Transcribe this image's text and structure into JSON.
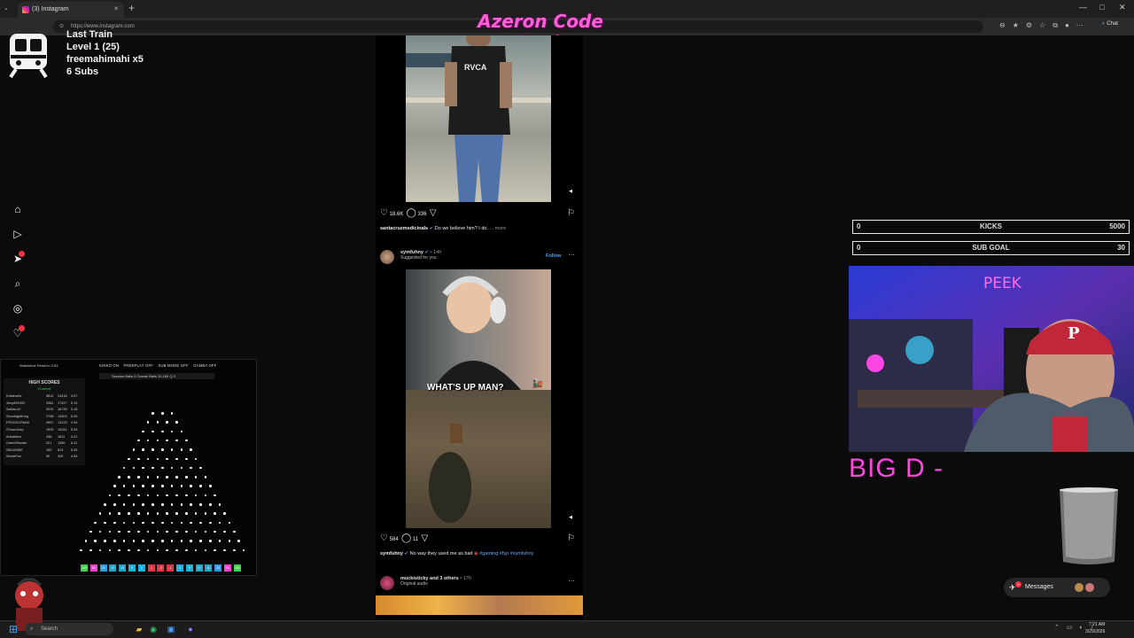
{
  "browser": {
    "tab_title": "(3) Instagram",
    "new_tab": "+",
    "url": "https://www.instagram.com",
    "chat_label": "Chat",
    "win_min": "—",
    "win_max": "□",
    "win_close": "✕"
  },
  "stream": {
    "title": "Azeron Code Peek",
    "train": {
      "title": "Last Train",
      "level": "Level 1  (25)",
      "user": "freemahimahi x5",
      "subs": "6 Subs"
    },
    "kicks": {
      "left": "0",
      "label": "KICKS",
      "right": "5000"
    },
    "sub_goal": {
      "left": "0",
      "label": "SUB GOAL",
      "right": "30"
    },
    "webcam_label": "PEEK",
    "big_text": "BIG D -"
  },
  "plinko": {
    "top_label": "Watchtime Reset in 2:53",
    "modes": [
      "KINKO ON",
      "FREEPLAY OFF",
      "SUB MODE OFF",
      "GAMBA OFF"
    ],
    "stats": "Session Balls  0     Overall Balls  20,185     Q  0",
    "hs_title": "HIGH SCORES",
    "hs_sub": "Channel",
    "scores": [
      {
        "name": "KristinaHe",
        "a": "5812",
        "b": "24418",
        "c": "4.07"
      },
      {
        "name": "Jerry851902",
        "a": "3381",
        "b": "17427",
        "c": "5.15"
      },
      {
        "name": "SaDaLuV",
        "a": "3232",
        "b": "16735",
        "c": "5.18"
      },
      {
        "name": "ShootdghtKing",
        "a": "2758",
        "b": "14303",
        "c": "5.20"
      },
      {
        "name": "FROGSCRIAM",
        "a": "2657",
        "b": "13123",
        "c": "4.94"
      },
      {
        "name": "STownJoey",
        "a": "1925",
        "b": "10251",
        "c": "5.33"
      },
      {
        "name": "Arkaldeeo",
        "a": "438",
        "b": "1811",
        "c": "4.21"
      },
      {
        "name": "GameShooter",
        "a": "221",
        "b": "1350",
        "c": "6.11"
      },
      {
        "name": "SNUXMEE",
        "a": "160",
        "b": "813",
        "c": "5.08"
      },
      {
        "name": "StevieFox",
        "a": "90",
        "b": "409",
        "c": "4.54"
      }
    ],
    "buckets": [
      "100",
      "50",
      "25",
      "10",
      "10",
      "5",
      "1",
      "-1",
      "-2",
      "-1",
      "1",
      "5",
      "10",
      "10",
      "25",
      "50",
      "100"
    ]
  },
  "feed": {
    "post1": {
      "shirt_text": "RVCA",
      "likes": "18.6K",
      "comments": "336",
      "caption_user": "santacruzmedicinals",
      "caption_text": "Do we believe him? I do.",
      "more": "... more"
    },
    "post2": {
      "user": "symfuhny",
      "time": "• 14h",
      "suggested": "Suggested for you",
      "follow": "Follow",
      "overlay_text": "WHAT'S UP MAN?",
      "likes": "584",
      "comments": "11",
      "caption_user": "symfuhny",
      "caption_text": "No way they used me as bait",
      "tags": "#gaming #fyp #symfuhny"
    },
    "post3": {
      "user": "muckisticky",
      "others": "and 3 others",
      "time": "• 17h",
      "audio": "Original audio"
    },
    "menu_dots": "···",
    "mute": "🔇"
  },
  "ig_sidebar": [
    "home-icon",
    "reels-icon",
    "explore-icon",
    "search-icon",
    "compass-icon",
    "heart-icon"
  ],
  "messages": {
    "label": "Messages",
    "count": "3"
  },
  "taskbar": {
    "search": "Search",
    "time": "7:21 AM",
    "date": "3/29/2026"
  },
  "colors": {
    "accent": "#ff45e3",
    "ig_blue": "#4aa1ff",
    "badge_red": "#ff3040"
  }
}
